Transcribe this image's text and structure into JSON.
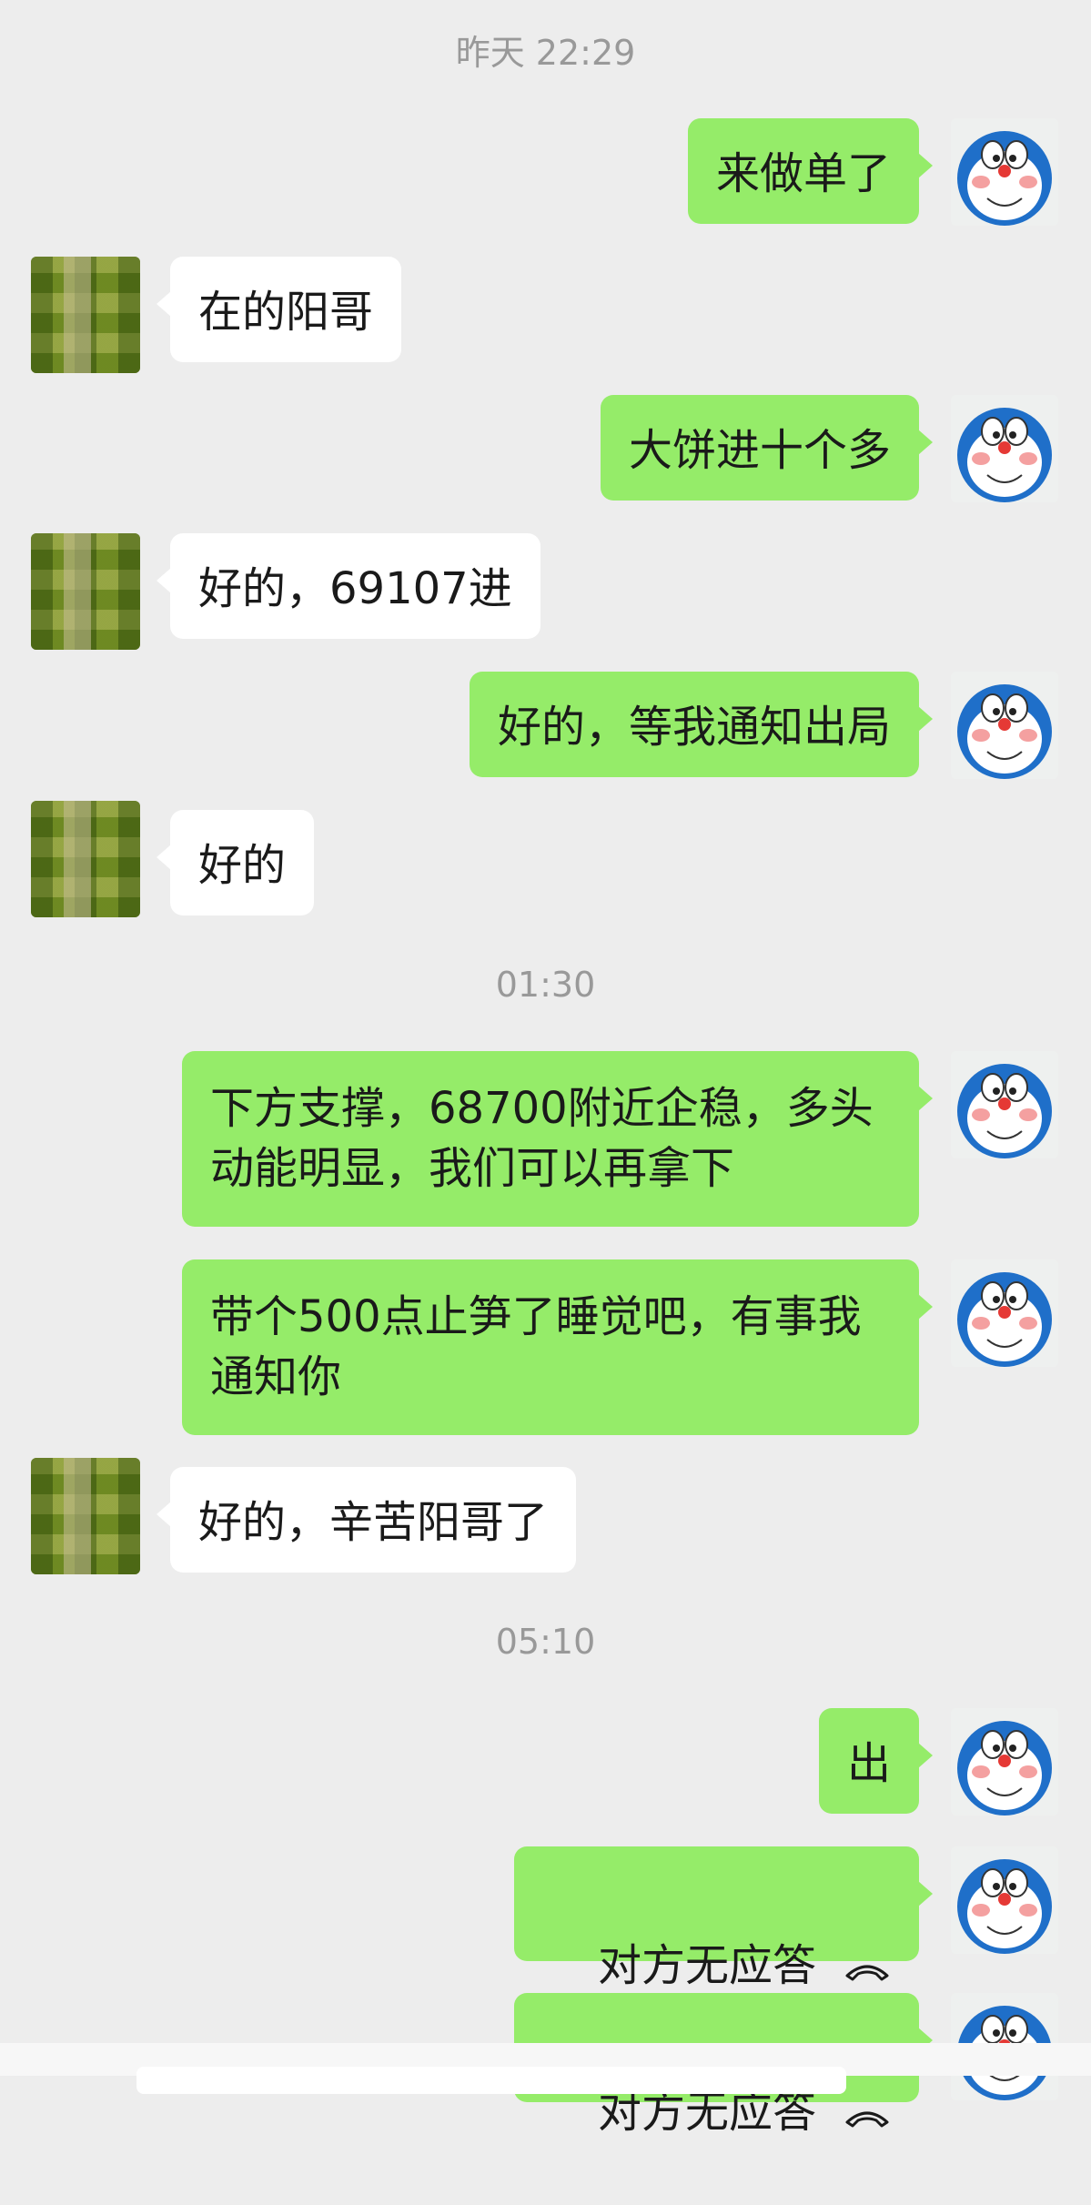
{
  "timestamps": [
    "昨天 22:29",
    "01:30",
    "05:10"
  ],
  "messages": [
    {
      "from": "self",
      "text": "来做单了"
    },
    {
      "from": "other",
      "text": "在的阳哥"
    },
    {
      "from": "self",
      "text": "大饼进十个多"
    },
    {
      "from": "other",
      "text": "好的，69107进"
    },
    {
      "from": "self",
      "text": "好的，等我通知出局"
    },
    {
      "from": "other",
      "text": "好的"
    },
    {
      "from": "self",
      "text": "下方支撑，68700附近企稳，多头\n动能明显，我们可以再拿下"
    },
    {
      "from": "self",
      "text": "带个500点止笋了睡觉吧，有事我\n通知你"
    },
    {
      "from": "other",
      "text": "好的，辛苦阳哥了"
    },
    {
      "from": "self",
      "text": "出"
    },
    {
      "from": "self",
      "text": "对方无应答",
      "icon": "phone-hangup-icon"
    },
    {
      "from": "self",
      "text": "对方无应答",
      "icon": "phone-hangup-icon"
    }
  ],
  "colors": {
    "self_bubble": "#95ec69",
    "other_bubble": "#ffffff",
    "background": "#ededed",
    "timestamp": "#999999"
  },
  "avatars": {
    "self": "doraemon-avatar",
    "other": "pixelated-avatar"
  }
}
